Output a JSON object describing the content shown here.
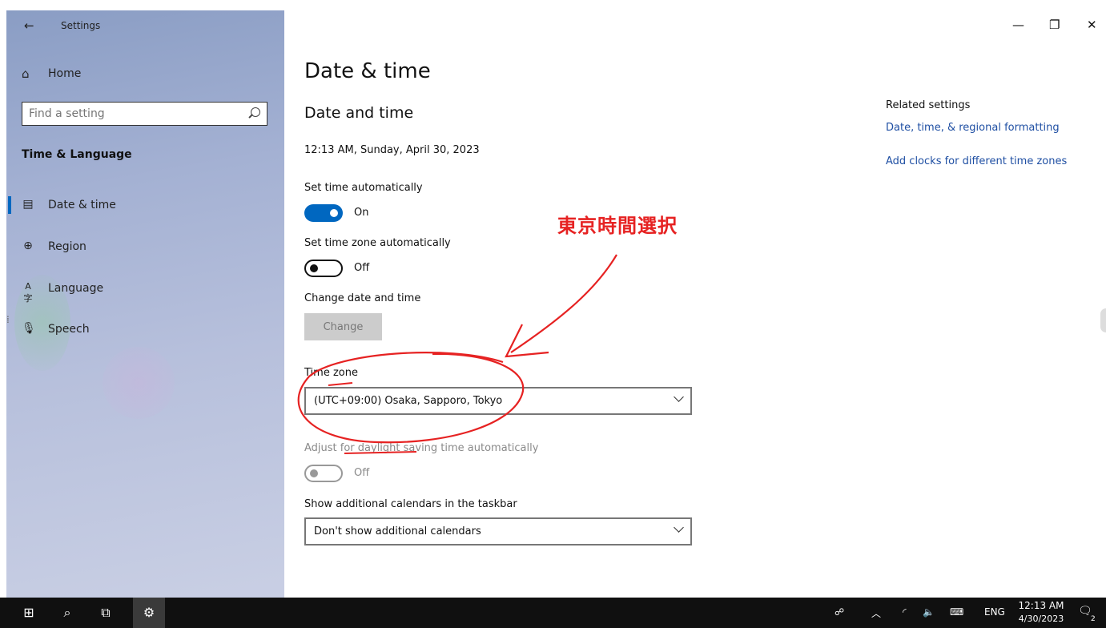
{
  "window": {
    "title": "Settings",
    "controls": {
      "minimize": "—",
      "restore": "❐",
      "close": "✕"
    }
  },
  "sidebar": {
    "home": {
      "label": "Home",
      "icon": "home-icon"
    },
    "search": {
      "placeholder": "Find a setting"
    },
    "section": "Time & Language",
    "items": [
      {
        "label": "Date & time",
        "icon": "calendar-clock-icon",
        "active": true
      },
      {
        "label": "Region",
        "icon": "globe-icon",
        "active": false
      },
      {
        "label": "Language",
        "icon": "language-icon",
        "active": false
      },
      {
        "label": "Speech",
        "icon": "microphone-icon",
        "active": false
      }
    ]
  },
  "main": {
    "page_title": "Date & time",
    "subtitle": "Date and time",
    "current_datetime": "12:13 AM, Sunday, April 30, 2023",
    "set_time_auto": {
      "label": "Set time automatically",
      "state": "On"
    },
    "set_zone_auto": {
      "label": "Set time zone automatically",
      "state": "Off"
    },
    "change_datetime": {
      "label": "Change date and time",
      "button": "Change"
    },
    "time_zone": {
      "label": "Time zone",
      "value": "(UTC+09:00) Osaka, Sapporo, Tokyo"
    },
    "daylight": {
      "label": "Adjust for daylight saving time automatically",
      "state": "Off"
    },
    "calendars": {
      "label": "Show additional calendars in the taskbar",
      "value": "Don't show additional calendars"
    }
  },
  "related": {
    "title": "Related settings",
    "links": [
      "Date, time, & regional formatting",
      "Add clocks for different time zones"
    ]
  },
  "annotation": {
    "text": "東京時間選択",
    "color": "#e62222"
  },
  "taskbar": {
    "tray_lang": "ENG",
    "clock_time": "12:13 AM",
    "clock_date": "4/30/2023",
    "notification_count": "2"
  },
  "colors": {
    "accent": "#0067c0",
    "link": "#1f4fa3",
    "annotation": "#e62222"
  }
}
